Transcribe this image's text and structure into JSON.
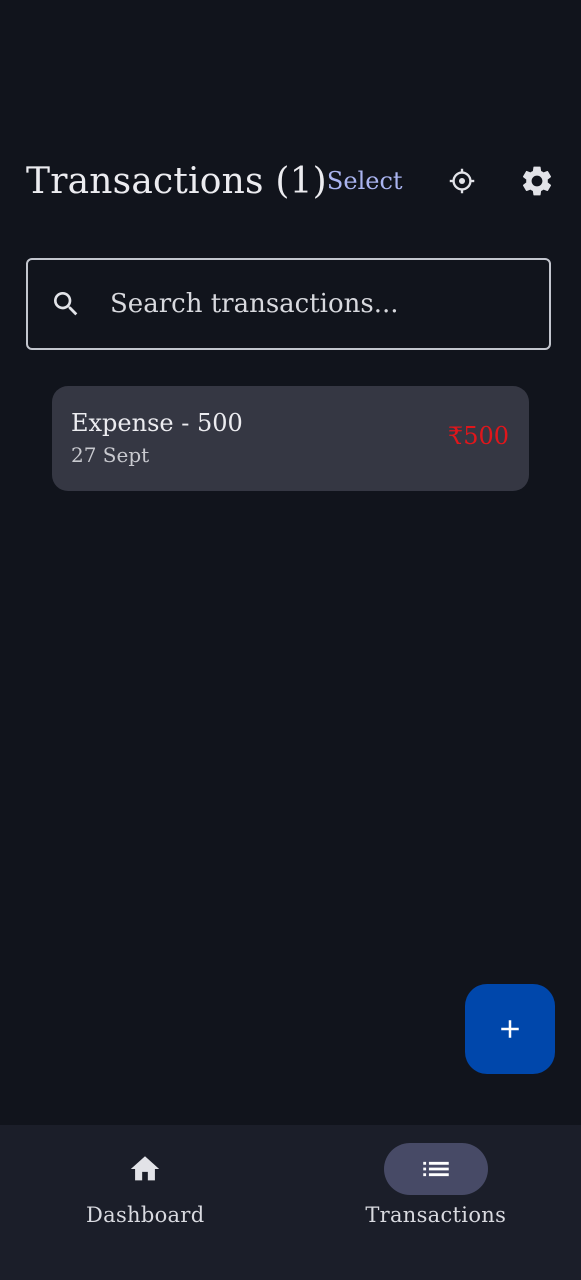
{
  "header": {
    "title": "Transactions (1)",
    "select_label": "Select",
    "filter_icon": "target-icon",
    "settings_icon": "gear-icon"
  },
  "search": {
    "placeholder": "Search transactions...",
    "value": "",
    "icon": "search-icon"
  },
  "transactions": [
    {
      "title": "Expense - 500",
      "date": "27 Sept",
      "amount": "₹500",
      "amount_color": "#e0161b"
    }
  ],
  "fab": {
    "icon": "plus-icon",
    "color": "#0047ab"
  },
  "bottom_nav": {
    "items": [
      {
        "label": "Dashboard",
        "icon": "home-icon",
        "active": false
      },
      {
        "label": "Transactions",
        "icon": "list-icon",
        "active": true
      }
    ]
  },
  "colors": {
    "background": "#11141c",
    "card": "#353743",
    "accent_text": "#aab4f0",
    "nav_bar": "#1b1e29",
    "nav_active_pill": "#474a66"
  }
}
